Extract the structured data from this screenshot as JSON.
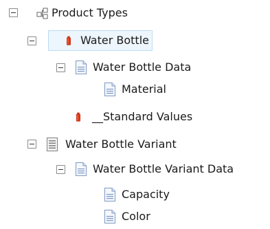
{
  "tree": {
    "root": {
      "label": "Product Types",
      "icon": "template-tree-icon"
    },
    "nodes": [
      {
        "id": "water-bottle",
        "label": "Water Bottle",
        "icon": "bottle-icon",
        "expanded": true,
        "selected": true
      },
      {
        "id": "water-bottle-data",
        "label": "Water Bottle Data",
        "icon": "document-icon",
        "expanded": true
      },
      {
        "id": "material",
        "label": "Material",
        "icon": "document-icon"
      },
      {
        "id": "standard-values",
        "label": "__Standard Values",
        "icon": "bottle-icon"
      },
      {
        "id": "water-bottle-variant",
        "label": "Water Bottle Variant",
        "icon": "form-template-icon",
        "expanded": true
      },
      {
        "id": "water-bottle-variant-data",
        "label": "Water Bottle Variant Data",
        "icon": "document-icon",
        "expanded": true
      },
      {
        "id": "capacity",
        "label": "Capacity",
        "icon": "document-icon"
      },
      {
        "id": "color",
        "label": "Color",
        "icon": "document-icon"
      }
    ]
  },
  "colors": {
    "selection_background": "#eef6fd",
    "selection_border": "#bcdcf4",
    "bottle_red": "#e23a16",
    "document_blue": "#7f99c3"
  }
}
